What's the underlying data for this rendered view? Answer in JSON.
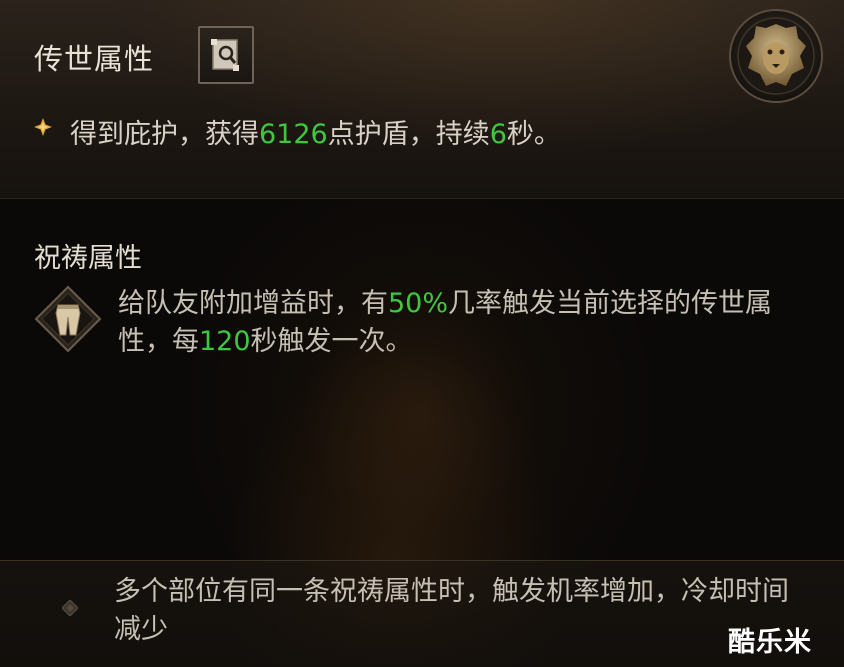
{
  "tooltip": {
    "legendary": {
      "title": "传世属性",
      "codex_icon": "codex-lookup-icon",
      "emblem_icon": "lion-head-emblem",
      "effect": {
        "prefix": "得到庇护，获得",
        "shield_value": "6126",
        "middle": "点护盾，持续",
        "duration": "6",
        "suffix": "秒。"
      }
    },
    "prayer": {
      "title": "祝祷属性",
      "item_icon": "pants-icon",
      "desc_part1": "给队友附加增益时，有",
      "chance": "50%",
      "desc_part2": "几率触发当前选择的传世属性，每",
      "cooldown": "120",
      "desc_part3": "秒触发一次。"
    },
    "note": {
      "text": "多个部位有同一条祝祷属性时，触发机率增加，冷却时间减少"
    },
    "watermark": "酷乐米"
  },
  "colors": {
    "highlight_green": "#3fc83f",
    "gold_accent": "#e0a63a",
    "text_primary": "#e9e2d6",
    "text_secondary": "#c6bfb3"
  }
}
